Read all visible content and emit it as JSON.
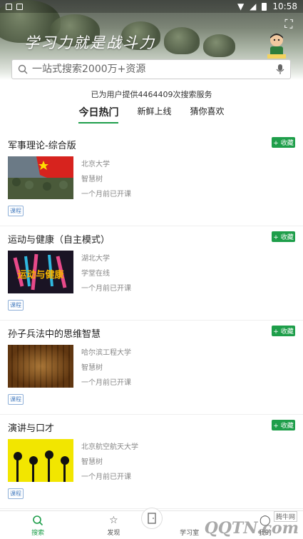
{
  "status_bar": {
    "time": "10:58"
  },
  "hero": {
    "slogan": "学习力就是战斗力"
  },
  "search": {
    "placeholder": "一站式搜索2000万+资源"
  },
  "stats_text": "已为用户提供4464409次搜索服务",
  "tabs": [
    {
      "label": "今日热门"
    },
    {
      "label": "新鲜上线"
    },
    {
      "label": "猜你喜欢"
    }
  ],
  "collect_label": "+ 收藏",
  "courses": [
    {
      "title": "军事理论-综合版",
      "school": "北京大学",
      "platform": "智慧树",
      "start": "一个月前已开课",
      "tag": "课程"
    },
    {
      "title": "运动与健康（自主模式）",
      "school": "湖北大学",
      "platform": "学堂在线",
      "start": "一个月前已开课",
      "tag": "课程",
      "thumb_text": "运动与健康"
    },
    {
      "title": "孙子兵法中的思维智慧",
      "school": "哈尔滨工程大学",
      "platform": "智慧树",
      "start": "一个月前已开课",
      "tag": "课程"
    },
    {
      "title": "演讲与口才",
      "school": "北京航空航天大学",
      "platform": "智慧树",
      "start": "一个月前已开课",
      "tag": "课程"
    }
  ],
  "bottom_nav": [
    {
      "label": "搜索",
      "icon": "search-icon"
    },
    {
      "label": "发现",
      "icon": "star-icon"
    },
    {
      "label": "学习室",
      "icon": "door-icon"
    },
    {
      "label": "我的",
      "icon": "user-icon"
    }
  ],
  "watermark": {
    "text": "QQTN.com",
    "badge": "腾牛网"
  },
  "colors": {
    "accent": "#1e9e4a",
    "tag": "#4a7fc1"
  }
}
